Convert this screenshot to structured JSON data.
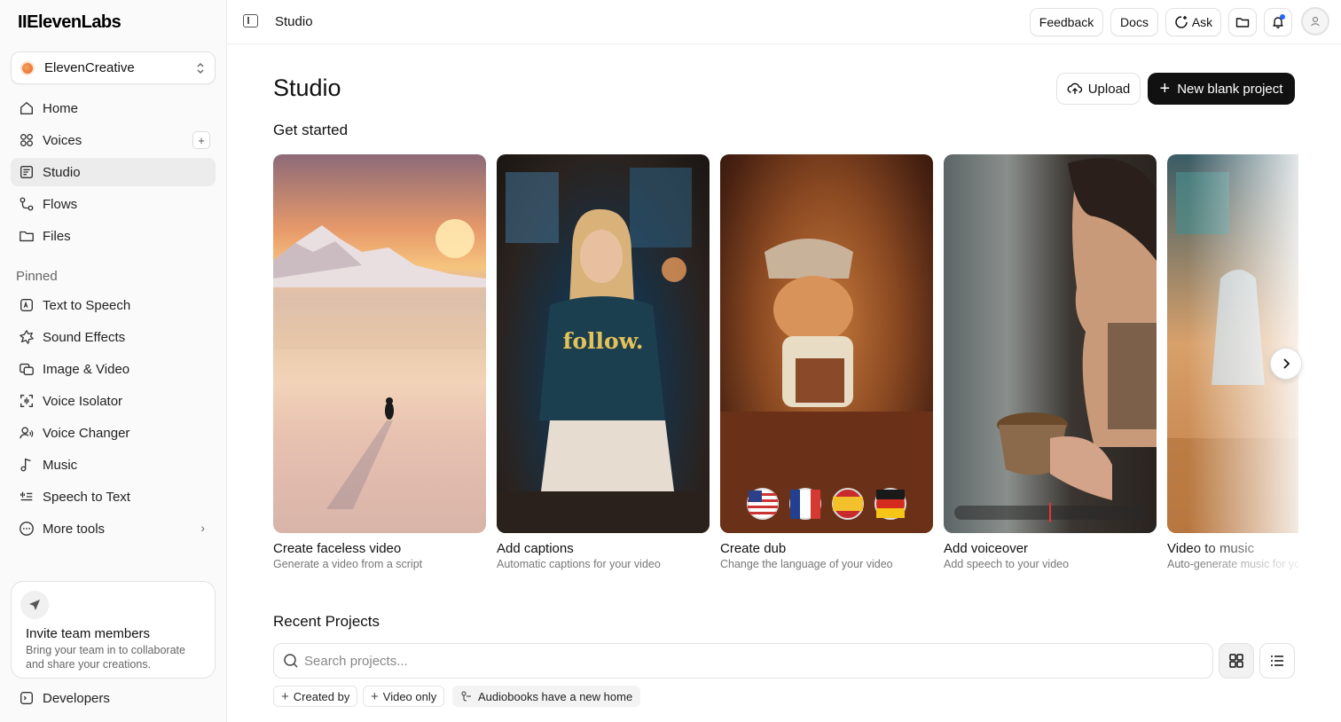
{
  "app": {
    "logo": "IIElevenLabs"
  },
  "workspace": {
    "name": "ElevenCreative"
  },
  "sidebar": {
    "items": [
      {
        "label": "Home",
        "icon": "home-icon"
      },
      {
        "label": "Voices",
        "icon": "voices-icon"
      },
      {
        "label": "Studio",
        "icon": "studio-icon",
        "active": true
      },
      {
        "label": "Flows",
        "icon": "flows-icon"
      },
      {
        "label": "Files",
        "icon": "folder-icon"
      }
    ],
    "pinned_label": "Pinned",
    "pinned": [
      {
        "label": "Text to Speech",
        "icon": "text-to-speech-icon"
      },
      {
        "label": "Sound Effects",
        "icon": "sound-effects-icon"
      },
      {
        "label": "Image & Video",
        "icon": "image-video-icon"
      },
      {
        "label": "Voice Isolator",
        "icon": "voice-isolator-icon"
      },
      {
        "label": "Voice Changer",
        "icon": "voice-changer-icon"
      },
      {
        "label": "Music",
        "icon": "music-icon"
      },
      {
        "label": "Speech to Text",
        "icon": "speech-to-text-icon"
      },
      {
        "label": "More tools",
        "icon": "more-icon"
      }
    ],
    "invite": {
      "title": "Invite team members",
      "subtitle": "Bring your team in to collaborate and share your creations."
    },
    "developers": "Developers"
  },
  "topbar": {
    "breadcrumb": "Studio",
    "feedback": "Feedback",
    "docs": "Docs",
    "ask": "Ask"
  },
  "main": {
    "title": "Studio",
    "upload": "Upload",
    "new_project": "New blank project",
    "get_started": "Get started",
    "cards": [
      {
        "title": "Create faceless video",
        "subtitle": "Generate a video from a script"
      },
      {
        "title": "Add captions",
        "subtitle": "Automatic captions for your video",
        "overlay": "follow."
      },
      {
        "title": "Create dub",
        "subtitle": "Change the language of your video"
      },
      {
        "title": "Add voiceover",
        "subtitle": "Add speech to your video"
      },
      {
        "title": "Video to music",
        "subtitle": "Auto-generate music for your video"
      }
    ],
    "recent_projects": "Recent Projects",
    "search_placeholder": "Search projects...",
    "chips": [
      "Created by",
      "Video only",
      "Audiobooks have a new home"
    ]
  },
  "colors": {
    "primary_button": "#111111",
    "notification": "#1f6bff"
  }
}
